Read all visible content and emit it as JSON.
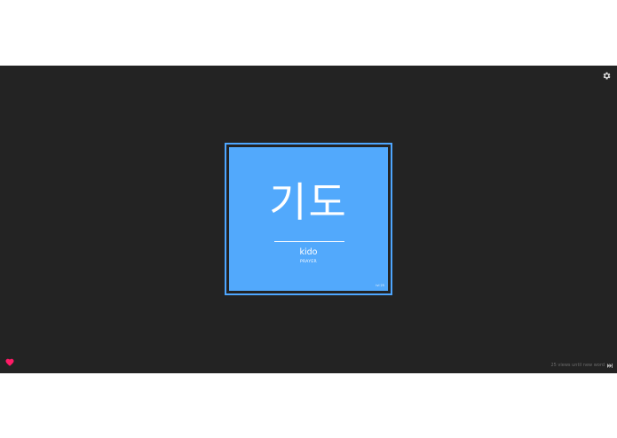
{
  "settings": {
    "icon": "gear-icon"
  },
  "card": {
    "hangul": "기도",
    "romanization": "kido",
    "meaning": "PRAYER",
    "level": "lvl 25"
  },
  "footer": {
    "status_text": "25 views until new word",
    "favorite_icon": "heart-icon",
    "skip_icon": "skip-forward-icon"
  },
  "colors": {
    "background": "#232323",
    "card": "#52a9fc",
    "card_border": "#4ea6ff",
    "heart": "#ff1a66",
    "muted_text": "#6c6c6c"
  }
}
